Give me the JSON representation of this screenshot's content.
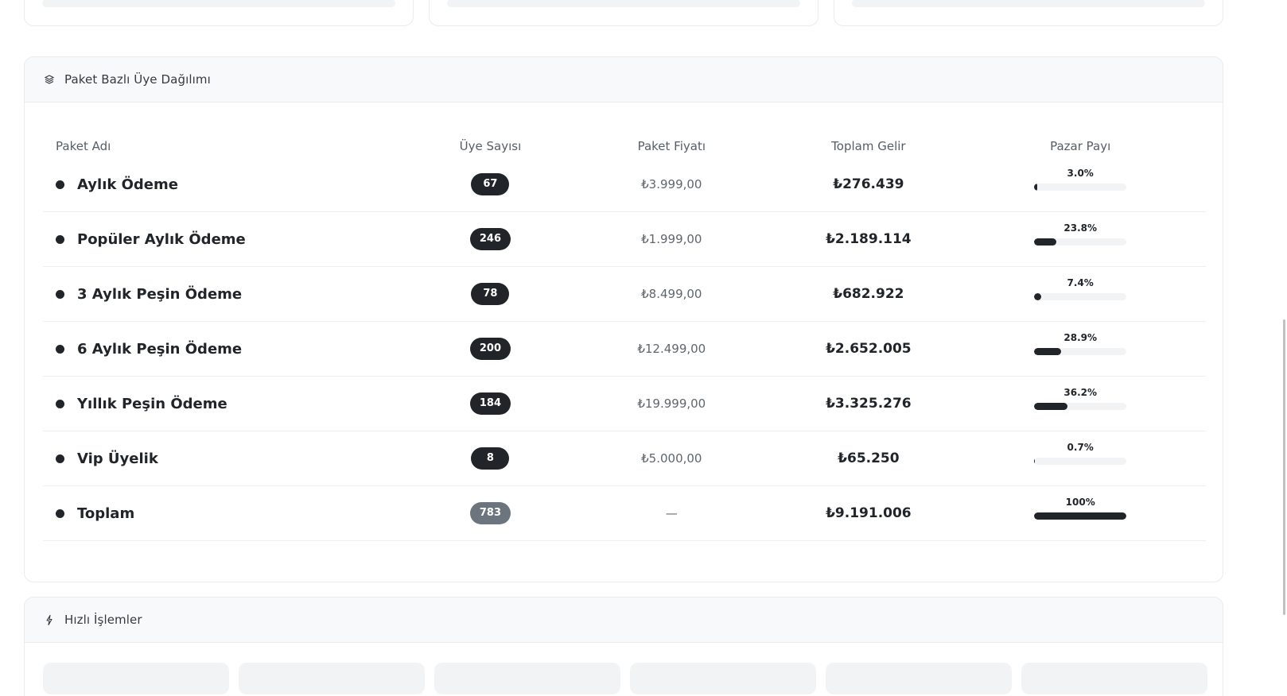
{
  "membership_card": {
    "title": "Paket Bazlı Üye Dağılımı",
    "icon": "layers-icon",
    "columns": {
      "name": "Paket Adı",
      "count": "Üye Sayısı",
      "price": "Paket Fiyatı",
      "total": "Toplam Gelir",
      "share": "Pazar Payı"
    },
    "rows": [
      {
        "name": "Aylık Ödeme",
        "count": "67",
        "price": "₺3.999,00",
        "total": "₺276.439",
        "share_label": "3.0%",
        "share": 3.0
      },
      {
        "name": "Popüler Aylık Ödeme",
        "count": "246",
        "price": "₺1.999,00",
        "total": "₺2.189.114",
        "share_label": "23.8%",
        "share": 23.8
      },
      {
        "name": "3 Aylık Peşin Ödeme",
        "count": "78",
        "price": "₺8.499,00",
        "total": "₺682.922",
        "share_label": "7.4%",
        "share": 7.4
      },
      {
        "name": "6 Aylık Peşin Ödeme",
        "count": "200",
        "price": "₺12.499,00",
        "total": "₺2.652.005",
        "share_label": "28.9%",
        "share": 28.9
      },
      {
        "name": "Yıllık Peşin Ödeme",
        "count": "184",
        "price": "₺19.999,00",
        "total": "₺3.325.276",
        "share_label": "36.2%",
        "share": 36.2
      },
      {
        "name": "Vip Üyelik",
        "count": "8",
        "price": "₺5.000,00",
        "total": "₺65.250",
        "share_label": "0.7%",
        "share": 0.7
      },
      {
        "name": "Toplam",
        "count": "783",
        "price": "—",
        "total": "₺9.191.006",
        "share_label": "100%",
        "share": 100
      }
    ]
  },
  "quick_actions": {
    "title": "Hızlı İşlemler",
    "icon": "lightning-icon"
  },
  "colors": {
    "badge": "#212529",
    "badge_total": "#6c757d",
    "bar_fill": "#212529",
    "bar_track": "#f1f3f5"
  }
}
